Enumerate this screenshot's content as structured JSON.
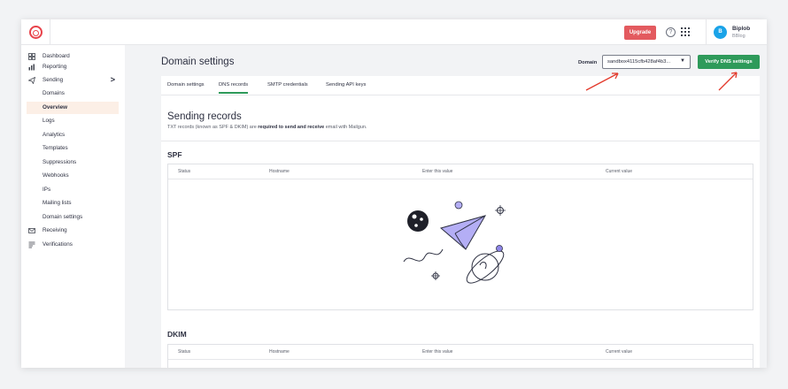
{
  "topbar": {
    "upgrade_label": "Upgrade",
    "help_glyph": "?",
    "user_initial": "B",
    "user_name": "Biplob",
    "user_sub": "BBlog"
  },
  "sidebar": {
    "items": [
      {
        "label": "Dashboard",
        "icon": "dashboard-icon"
      },
      {
        "label": "Reporting",
        "icon": "reporting-icon"
      },
      {
        "label": "Sending",
        "icon": "sending-icon",
        "chevron": ">"
      },
      {
        "label": "Domains"
      },
      {
        "label": "Overview",
        "active": true
      },
      {
        "label": "Logs"
      },
      {
        "label": "Analytics"
      },
      {
        "label": "Templates"
      },
      {
        "label": "Suppressions"
      },
      {
        "label": "Webhooks"
      },
      {
        "label": "IPs"
      },
      {
        "label": "Mailing lists"
      },
      {
        "label": "Domain settings"
      },
      {
        "label": "Receiving",
        "icon": "receiving-icon"
      },
      {
        "label": "Verifications",
        "icon": "verifications-icon"
      }
    ]
  },
  "main": {
    "title": "Domain settings",
    "domain_label": "Domain",
    "domain_value": "sandbox4115cfb428af4b3...",
    "verify_label": "Verify DNS settings",
    "tabs": [
      {
        "label": "Domain settings"
      },
      {
        "label": "DNS records",
        "active": true
      },
      {
        "label": "SMTP credentials"
      },
      {
        "label": "Sending API keys"
      }
    ],
    "section_title": "Sending records",
    "section_desc_1": "TXT records (known as SPF & DKIM) are",
    "section_desc_bold": "required to send and receive",
    "section_desc_2": "email with Mailgun.",
    "spf_title": "SPF",
    "dkim_title": "DKIM",
    "table_headers": [
      "Status",
      "Hostname",
      "Enter this value",
      "Current value"
    ]
  },
  "colors": {
    "accent_green": "#2e9a5a",
    "upgrade_red": "#e35a5f",
    "brand_red": "#e8424a",
    "avatar_blue": "#1aa3e8",
    "illustration_purple": "#b4aef5",
    "annotation_arrow": "#e33a2c"
  }
}
